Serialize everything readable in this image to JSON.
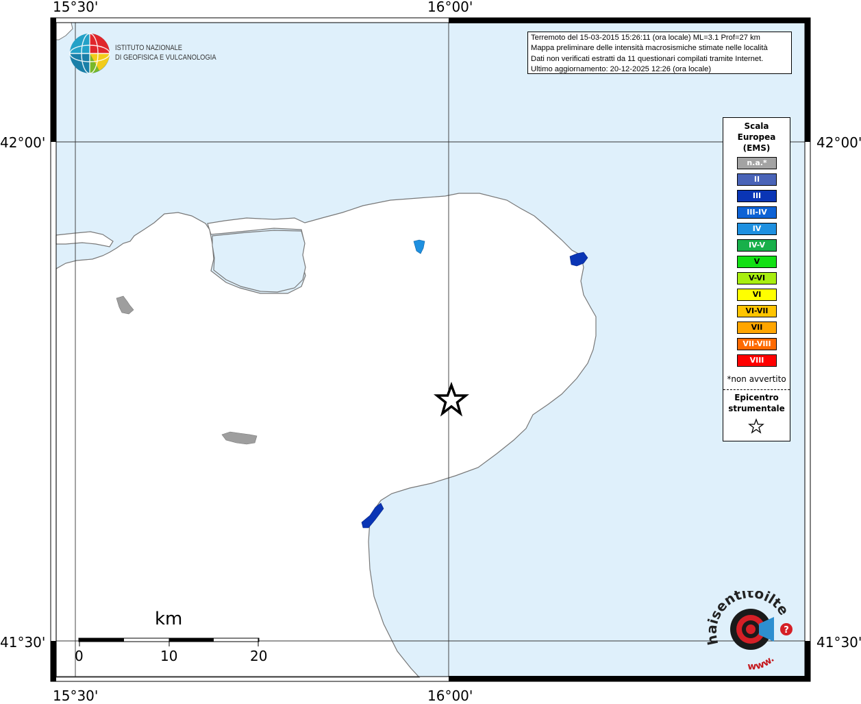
{
  "map": {
    "coords": {
      "lon_left": "15°30'",
      "lon_center": "16°00'",
      "lat_top": "42°00'",
      "lat_bottom": "41°30'"
    },
    "colors": {
      "sea": "#dff0fb",
      "land": "#ffffff",
      "coast": "#777777",
      "unfelt": "#9e9e9e",
      "intensity_III": "#0a35b5",
      "intensity_IV": "#1e90e0"
    },
    "epicenter_marker": "star-icon"
  },
  "info": {
    "line1": "Terremoto del 15-03-2015 15:26:11 (ora locale) ML=3.1 Prof=27 km",
    "line2": "Mappa preliminare delle intensità macrosismiche stimate nelle località",
    "line3": "Dati non verificati estratti da 11 questionari compilati tramite Internet.",
    "line4": "Ultimo aggiornamento: 20-12-2025 12:26 (ora locale)"
  },
  "legend": {
    "title_line1": "Scala",
    "title_line2": "Europea",
    "title_line3": "(EMS)",
    "items": [
      {
        "label": "n.a.*",
        "color": "#a3a3a3"
      },
      {
        "label": "II",
        "color": "#4a64b8"
      },
      {
        "label": "III",
        "color": "#0a35b5"
      },
      {
        "label": "III-IV",
        "color": "#0d62d5"
      },
      {
        "label": "IV",
        "color": "#1e90e0"
      },
      {
        "label": "IV-V",
        "color": "#18b04a"
      },
      {
        "label": "V",
        "color": "#12e014"
      },
      {
        "label": "V-VI",
        "color": "#a8ee10"
      },
      {
        "label": "VI",
        "color": "#ffff00"
      },
      {
        "label": "VI-VII",
        "color": "#ffc400"
      },
      {
        "label": "VII",
        "color": "#ffa500"
      },
      {
        "label": "VII-VIII",
        "color": "#ff6a00"
      },
      {
        "label": "VIII",
        "color": "#ff0000"
      }
    ],
    "note": "*non avvertito",
    "epicenter_line1": "Epicentro",
    "epicenter_line2": "strumentale"
  },
  "logos": {
    "ingv_line1": "ISTITUTO NAZIONALE",
    "ingv_line2": "DI GEOFISICA E VULCANOLOGIA",
    "hsi_text": "haisentitoilterremoto.it",
    "hsi_url": "www."
  },
  "scalebar": {
    "unit": "km",
    "ticks": [
      "0",
      "10",
      "20"
    ]
  }
}
